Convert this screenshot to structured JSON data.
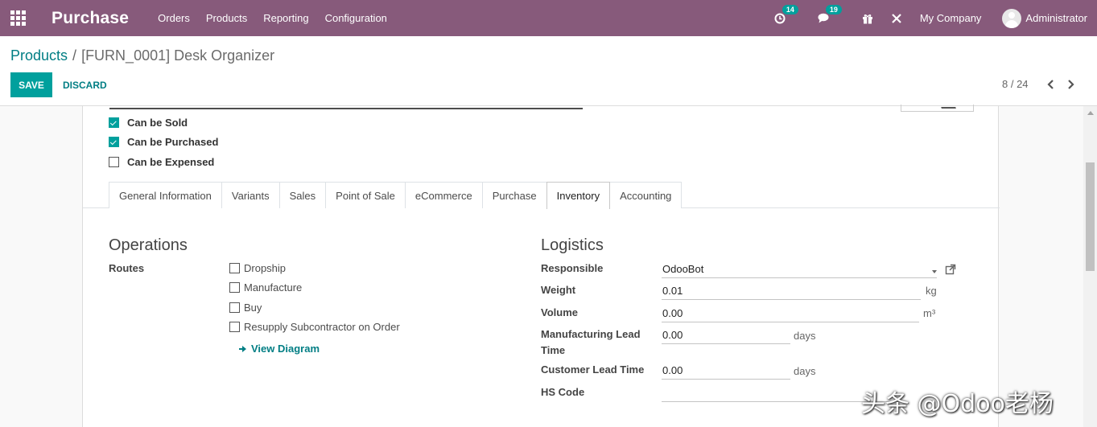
{
  "navbar": {
    "app_name": "Purchase",
    "menu": [
      "Orders",
      "Products",
      "Reporting",
      "Configuration"
    ],
    "activity_count": "14",
    "messages_count": "19",
    "company": "My Company",
    "user": "Administrator",
    "icons": [
      "apps-grid-icon",
      "clock-icon",
      "chat-icon",
      "gift-icon",
      "debug-icon",
      "avatar"
    ]
  },
  "breadcrumb": {
    "parent": "Products",
    "separator": "/",
    "current": "[FURN_0001] Desk Organizer"
  },
  "buttons": {
    "save": "SAVE",
    "discard": "DISCARD"
  },
  "pager": {
    "value": "8 / 24"
  },
  "checkboxes": [
    {
      "label": "Can be Sold",
      "checked": true
    },
    {
      "label": "Can be Purchased",
      "checked": true
    },
    {
      "label": "Can be Expensed",
      "checked": false
    }
  ],
  "tabs": [
    "General Information",
    "Variants",
    "Sales",
    "Point of Sale",
    "eCommerce",
    "Purchase",
    "Inventory",
    "Accounting"
  ],
  "active_tab": "Inventory",
  "operations": {
    "title": "Operations",
    "routes_label": "Routes",
    "routes": [
      {
        "label": "Dropship",
        "checked": false
      },
      {
        "label": "Manufacture",
        "checked": false
      },
      {
        "label": "Buy",
        "checked": false
      },
      {
        "label": "Resupply Subcontractor on Order",
        "checked": false
      }
    ],
    "view_diagram": "View Diagram"
  },
  "logistics": {
    "title": "Logistics",
    "responsible_label": "Responsible",
    "responsible_value": "OdooBot",
    "weight_label": "Weight",
    "weight_value": "0.01",
    "weight_unit": "kg",
    "volume_label": "Volume",
    "volume_value": "0.00",
    "volume_unit": "m³",
    "mfg_lead_label_1": "Manufacturing Lead",
    "mfg_lead_label_2": "Time",
    "mfg_lead_value": "0.00",
    "mfg_lead_unit": "days",
    "customer_lead_label": "Customer Lead Time",
    "customer_lead_value": "0.00",
    "customer_lead_unit": "days",
    "hs_code_label": "HS Code",
    "hs_code_value": ""
  },
  "watermark": "头条 @Odoo老杨",
  "colors": {
    "navbar": "#875a7b",
    "primary": "#00a09d",
    "link": "#017e84"
  }
}
